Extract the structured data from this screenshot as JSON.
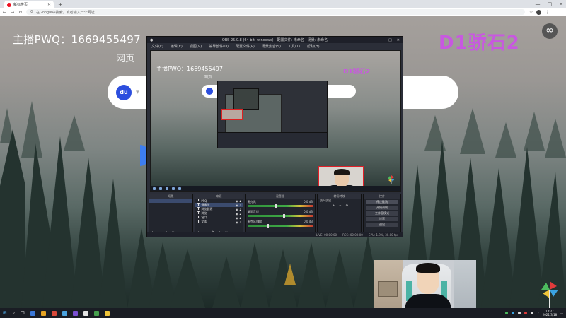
{
  "browser": {
    "tab_title": "新标签页",
    "new_tab": "+",
    "omnibox_placeholder": "在Google中搜索，或者输入一个网址",
    "window_controls": [
      "—",
      "□",
      "✕"
    ]
  },
  "newtab_page": {
    "anchor_text": "主播PWQ：1669455497",
    "webpage_label": "网页",
    "brand_text": "D1骄石2",
    "search_logo": "du",
    "infinity_symbol": "∞"
  },
  "obs": {
    "title": "OBS 25.0.8 (64 bit, windows) - 配置文件: 未命名 - 场景: 未命名",
    "menu": [
      "文件(F)",
      "编辑(E)",
      "视图(V)",
      "停靠部件(D)",
      "配置文件(P)",
      "场景集合(S)",
      "工具(T)",
      "帮助(H)"
    ],
    "preview": {
      "anchor_text": "主播PWQ：1669455497",
      "webpage_label": "网页",
      "brand_text": "D1骄石2"
    },
    "docks": {
      "scenes_header": "场景",
      "sources_header": "来源",
      "mixer_header": "混音器",
      "transitions_header": "转场特效",
      "controls_header": "控件"
    },
    "sources": [
      {
        "icon": "T",
        "name": "PPQ"
      },
      {
        "icon": "T",
        "name": "摄像头",
        "selected": true
      },
      {
        "icon": "T",
        "name": "浏览器源"
      },
      {
        "icon": "T",
        "name": "浏览"
      },
      {
        "icon": "T",
        "name": "窗口"
      },
      {
        "icon": "T",
        "name": "文本"
      }
    ],
    "mixer": [
      {
        "name": "麦克风",
        "db": "0.0 dB",
        "level": 0.42
      },
      {
        "name": "桌面音频",
        "db": "0.0 dB",
        "level": 0.55
      },
      {
        "name": "麦克风/辅助",
        "db": "0.0 dB",
        "level": 0.3
      }
    ],
    "transition_name": "淡入淡出",
    "controls": [
      "停止推流",
      "开始录制",
      "工作室模式",
      "设置",
      "退出"
    ],
    "status": [
      "LIVE: 00:00:00",
      "REC: 00:00:00",
      "CPU: 1.9%, 30.00 fps"
    ]
  },
  "taskbar": {
    "time": "14:27",
    "date": "2021/3/18",
    "colors": {
      "app1": "#3b78d8",
      "app2": "#e5a323",
      "app3": "#d94a3b",
      "app4": "#4aa3df",
      "app5": "#7a4fd1",
      "app6": "#e4e4e4",
      "app7": "#46a04e",
      "app8": "#f0c53a"
    }
  }
}
